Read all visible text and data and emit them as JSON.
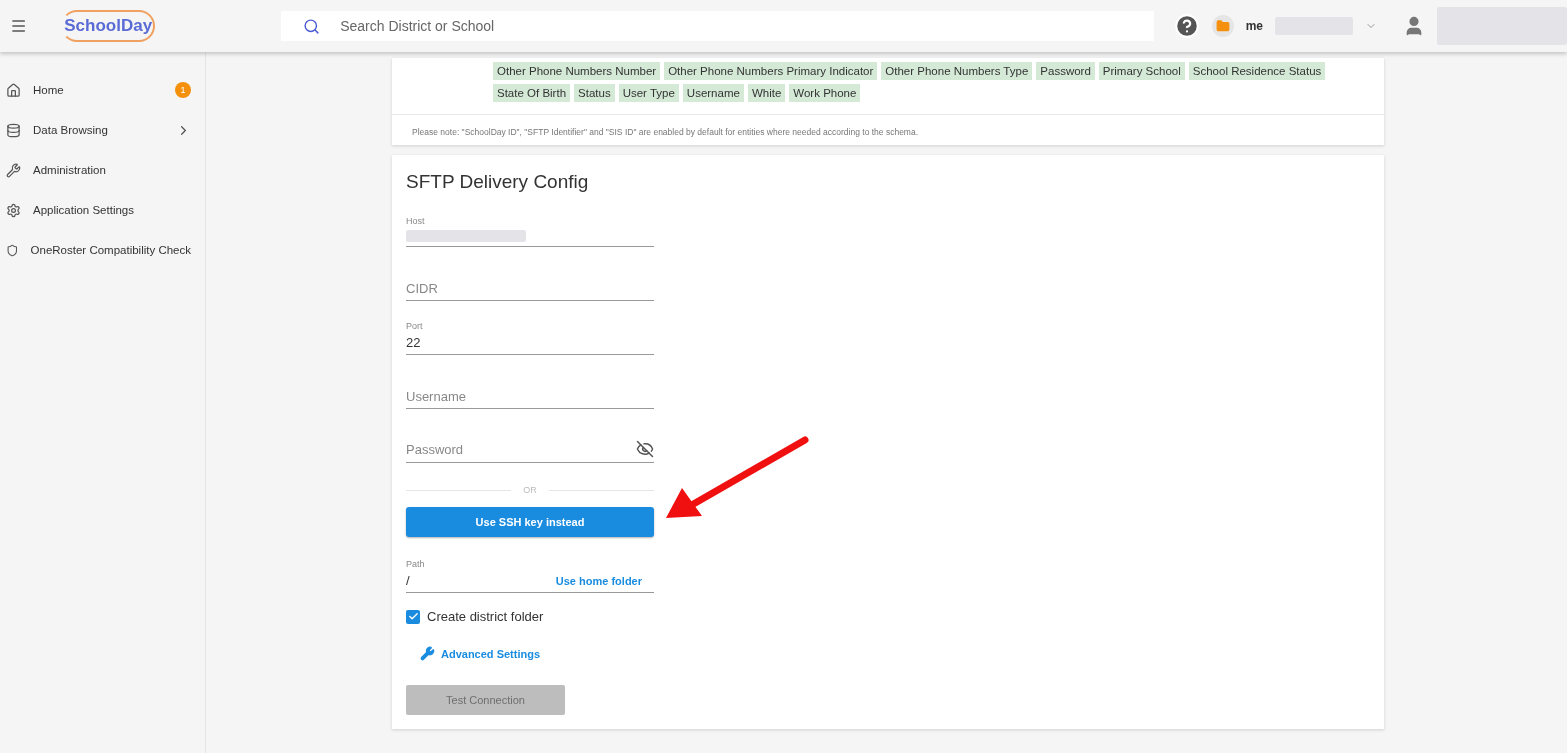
{
  "header": {
    "logo": "SchoolDay",
    "search": {
      "placeholder": "Search District or School"
    },
    "account": "me"
  },
  "sidebar": {
    "items": [
      {
        "label": "Home",
        "badge": "1",
        "has_children": false
      },
      {
        "label": "Data Browsing",
        "has_children": true
      },
      {
        "label": "Administration",
        "has_children": false
      },
      {
        "label": "Application Settings",
        "has_children": false
      },
      {
        "label": "OneRoster Compatibility Check",
        "has_children": false
      }
    ]
  },
  "fields_card": {
    "tag_rows": [
      [
        "Other Phone Numbers Number",
        "Other Phone Numbers Primary Indicator",
        "Other Phone Numbers Type",
        "Password",
        "Primary School",
        "School Residence Status"
      ],
      [
        "State Of Birth",
        "Status",
        "User Type",
        "Username",
        "White",
        "Work Phone"
      ]
    ],
    "note": "Please note: \"SchoolDay ID\", \"SFTP Identifier\" and \"SIS ID\" are enabled by default for entities where needed according to the schema."
  },
  "sftp": {
    "title": "SFTP Delivery Config",
    "fields": [
      {
        "kind": "redacted",
        "label": "Host"
      },
      {
        "kind": "empty",
        "placeholder": "CIDR"
      },
      {
        "kind": "value",
        "label": "Port",
        "value": "22"
      },
      {
        "kind": "empty",
        "placeholder": "Username"
      },
      {
        "kind": "password",
        "placeholder": "Password"
      }
    ],
    "divider": "OR",
    "ssh_button": "Use SSH key instead",
    "path": {
      "label": "Path",
      "value": "/",
      "action": "Use home folder"
    },
    "create_folder": {
      "label": "Create district folder",
      "checked": true
    },
    "advanced": "Advanced Settings",
    "test_button": {
      "label": "Test Connection",
      "disabled": true
    }
  }
}
